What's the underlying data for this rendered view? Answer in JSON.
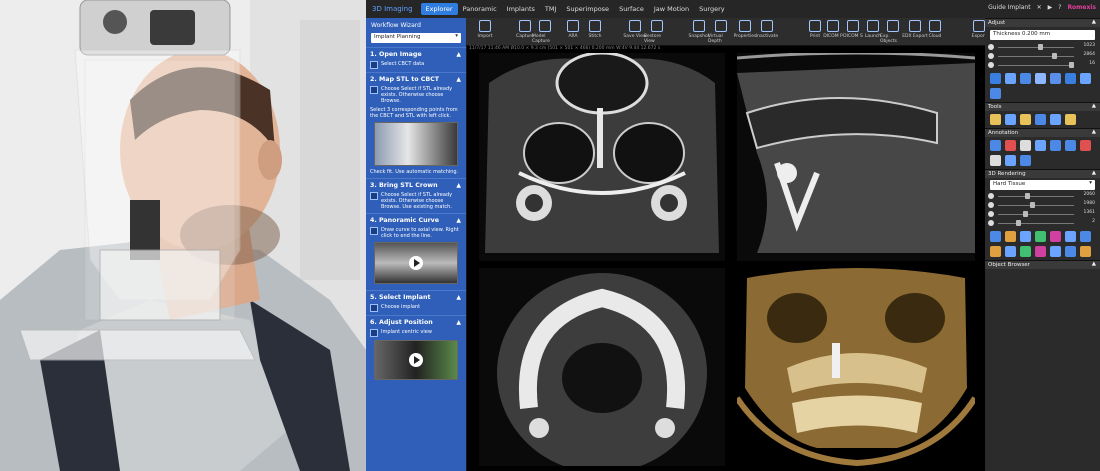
{
  "app": {
    "brand": "3D Imaging",
    "tabs": [
      "Explorer",
      "Panoramic",
      "Implants",
      "TMJ",
      "Superimpose",
      "Surface",
      "Jaw Motion",
      "Surgery"
    ],
    "active_tab": "Explorer",
    "top_right": "Guide Implant",
    "vendor": "Romexis"
  },
  "toolbar": [
    {
      "label": "Import",
      "icon": "import-icon"
    },
    {
      "label": "Capture",
      "icon": "camera-icon"
    },
    {
      "label": "Model Capture",
      "icon": "model-capture-icon"
    },
    {
      "label": "ARA",
      "icon": "ara-icon"
    },
    {
      "label": "Stitch",
      "icon": "stitch-icon"
    },
    {
      "label": "Save View",
      "icon": "save-view-icon"
    },
    {
      "label": "Restore View",
      "icon": "restore-view-icon"
    },
    {
      "label": "Snapshot",
      "icon": "snapshot-icon"
    },
    {
      "label": "Virtual Depth",
      "icon": "virtual-depth-icon"
    },
    {
      "label": "Properties",
      "icon": "properties-icon"
    },
    {
      "label": "Inactivate",
      "icon": "inactivate-icon"
    },
    {
      "label": "Print",
      "icon": "print-icon"
    },
    {
      "label": "DICOM P",
      "icon": "dicom-print-icon"
    },
    {
      "label": "DICOM S",
      "icon": "dicom-send-icon"
    },
    {
      "label": "Launch",
      "icon": "launch-icon"
    },
    {
      "label": "Exp. Objects",
      "icon": "export-objects-icon"
    },
    {
      "label": "EDX Export",
      "icon": "edx-export-icon"
    },
    {
      "label": "Cloud",
      "icon": "cloud-icon"
    },
    {
      "label": "Export",
      "icon": "export-icon"
    }
  ],
  "wizard": {
    "title": "Workflow Wizard",
    "mode": "Implant Planning",
    "steps": [
      {
        "title": "1. Open Image",
        "text": "Select CBCT data"
      },
      {
        "title": "2. Map STL to CBCT",
        "text": "Choose Select if STL already exists. Otherwise choose Browse.",
        "extra": "Select 3 corresponding points from the CBCT and STL with left click.",
        "after": "Check fit. Use automatic matching."
      },
      {
        "title": "3. Bring STL Crown",
        "text": "Choose Select if STL already exists. Otherwise choose Browse. Use existing match."
      },
      {
        "title": "4. Panoramic Curve",
        "text": "Draw curve to axial view. Right click to end the line."
      },
      {
        "title": "5. Select Implant",
        "text": "Choose implant"
      },
      {
        "title": "6. Adjust Position",
        "text": "Implant centric view"
      }
    ]
  },
  "viewer": {
    "status": "11/7/17 11:46 AM  Ø10.0 × 9.3 cm  (501 × 501 × 466)  0.200 mm  W:4V 9.44 12.672 s"
  },
  "right_panel": {
    "adjust": {
      "title": "Adjust",
      "thickness_label": "Thickness",
      "thickness_value": "0.200 mm",
      "sliders": [
        {
          "icon": "contrast-icon",
          "value": "1023",
          "level": 0.55
        },
        {
          "icon": "brightness-icon",
          "value": "2864",
          "level": 0.75
        },
        {
          "icon": "gamma-icon",
          "value": "16",
          "level": 0.98
        }
      ]
    },
    "tools_title": "Tools",
    "annotation_title": "Annotation",
    "rendering": {
      "title": "3D Rendering",
      "preset": "Hard Tissue",
      "sliders": [
        {
          "icon": "contrast-icon",
          "value": "2060",
          "level": 0.38
        },
        {
          "icon": "brightness-icon",
          "value": "1980",
          "level": 0.45
        },
        {
          "icon": "opacity-icon",
          "value": "1361",
          "level": 0.35
        },
        {
          "icon": "gamma-icon",
          "value": "2",
          "level": 0.25
        }
      ]
    },
    "object_browser_title": "Object Browser"
  }
}
